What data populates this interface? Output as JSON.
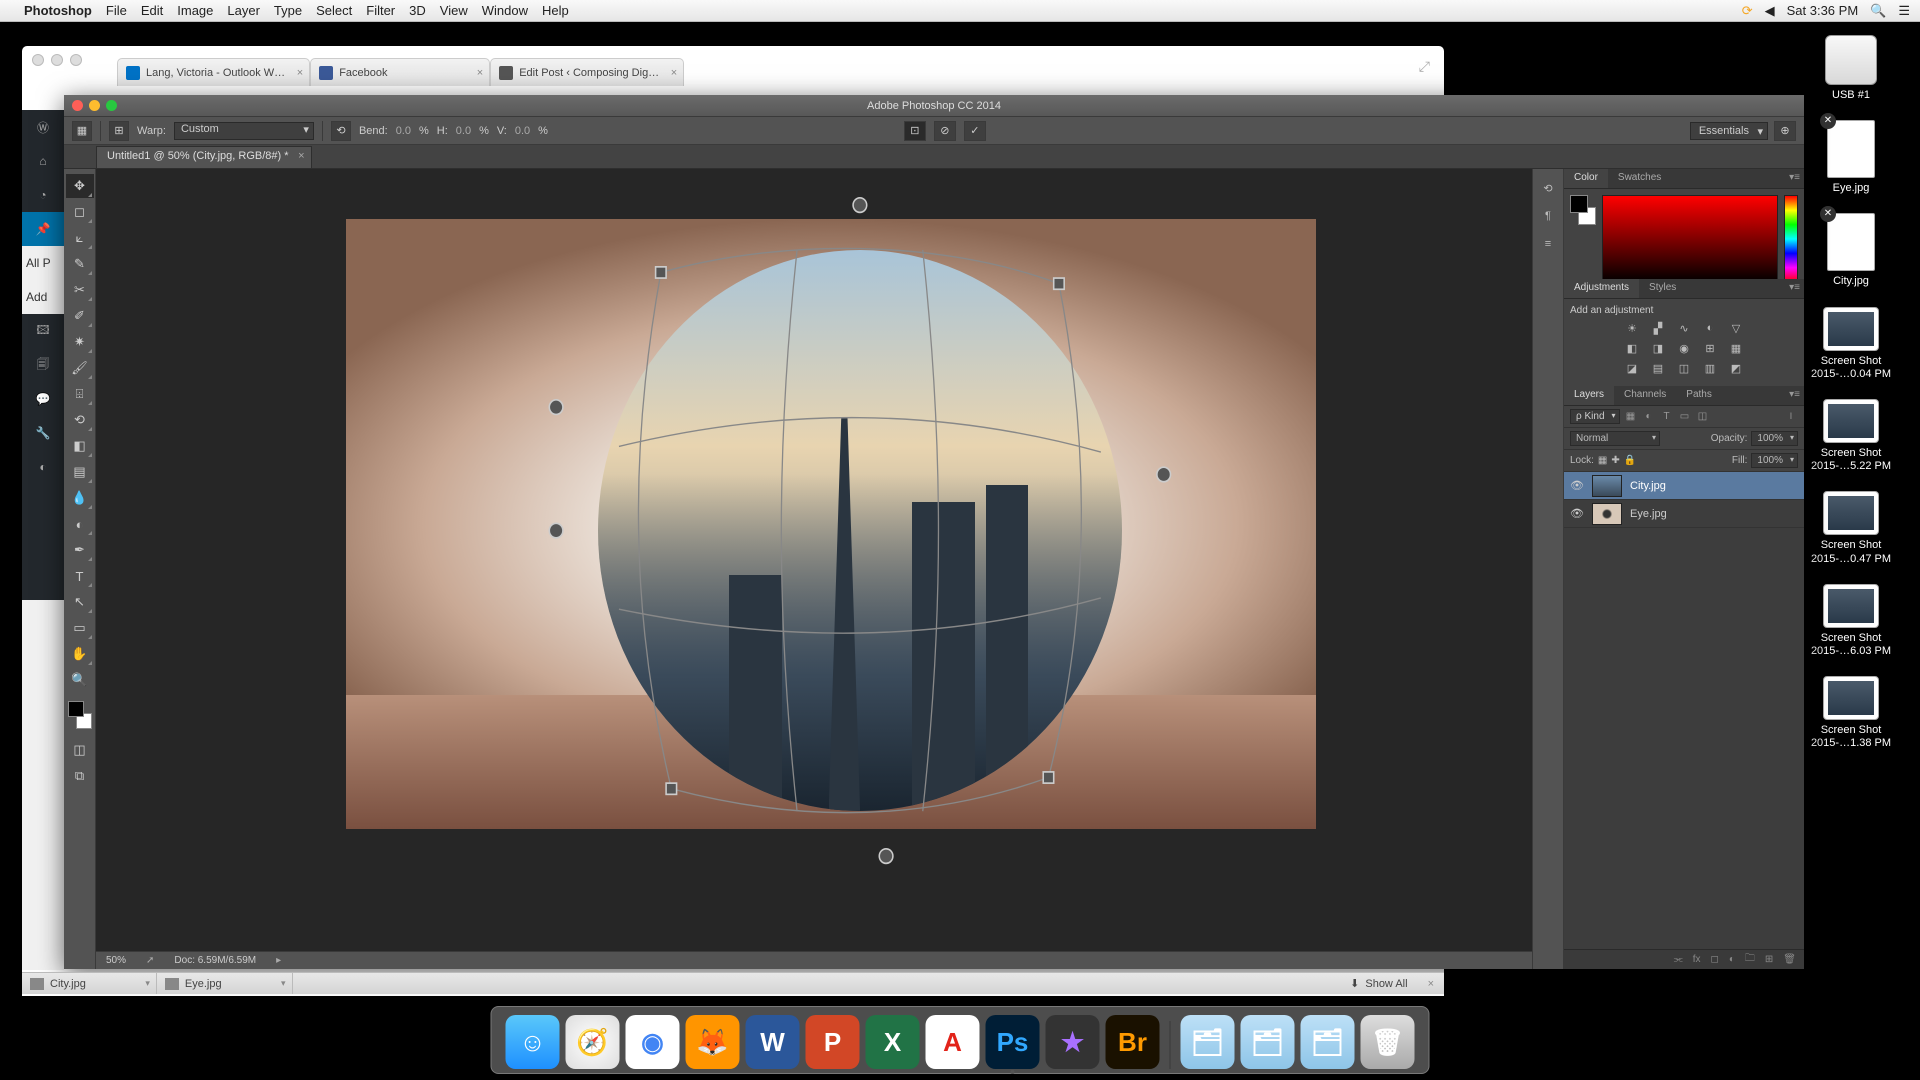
{
  "menubar": {
    "app": "Photoshop",
    "items": [
      "File",
      "Edit",
      "Image",
      "Layer",
      "Type",
      "Select",
      "Filter",
      "3D",
      "View",
      "Window",
      "Help"
    ],
    "clock": "Sat 3:36 PM"
  },
  "desktop": {
    "drive": "USB #1",
    "files": [
      "Eye.jpg",
      "City.jpg",
      "Screen Shot 2015-…0.04 PM",
      "Screen Shot 2015-…5.22 PM",
      "Screen Shot 2015-…0.47 PM",
      "Screen Shot 2015-…6.03 PM",
      "Screen Shot 2015-…1.38 PM"
    ]
  },
  "browser": {
    "tabs": [
      {
        "label": "Lang, Victoria - Outlook W…",
        "icon": "outlook"
      },
      {
        "label": "Facebook",
        "icon": "fb"
      },
      {
        "label": "Edit Post ‹ Composing Dig…",
        "icon": "wp"
      }
    ]
  },
  "wp_sidebar": {
    "items": [
      "D",
      "☆",
      "J",
      "📌",
      "P",
      "A",
      "P",
      "F",
      "T",
      "⚙"
    ],
    "active_index": 3,
    "labels": [
      "All P",
      "Add"
    ]
  },
  "photoshop": {
    "title": "Adobe Photoshop CC 2014",
    "options": {
      "warp_label": "Warp:",
      "warp_mode": "Custom",
      "bend_label": "Bend:",
      "bend_value": "0.0",
      "h_label": "H:",
      "h_value": "0.0",
      "v_label": "V:",
      "v_value": "0.0",
      "pct": "%",
      "workspace": "Essentials"
    },
    "document_tab": "Untitled1 @ 50% (City.jpg, RGB/8#) *",
    "status": {
      "zoom": "50%",
      "doc": "Doc: 6.59M/6.59M"
    },
    "panels": {
      "color": {
        "tabs": [
          "Color",
          "Swatches"
        ],
        "active": 0
      },
      "adjustments": {
        "tabs": [
          "Adjustments",
          "Styles"
        ],
        "active": 0,
        "add_label": "Add an adjustment"
      },
      "layers": {
        "tabs": [
          "Layers",
          "Channels",
          "Paths"
        ],
        "active": 0,
        "filter_kind": "Kind",
        "blend_mode": "Normal",
        "opacity_label": "Opacity:",
        "opacity_value": "100%",
        "lock_label": "Lock:",
        "fill_label": "Fill:",
        "fill_value": "100%",
        "items": [
          {
            "name": "City.jpg",
            "selected": true,
            "thumb": "city"
          },
          {
            "name": "Eye.jpg",
            "selected": false,
            "thumb": "eye"
          }
        ]
      }
    }
  },
  "bottom_files": {
    "items": [
      "City.jpg",
      "Eye.jpg"
    ],
    "showall": "Show All"
  },
  "dock": {
    "apps": [
      {
        "name": "finder",
        "bg": "linear-gradient(#5ac8fa,#1e90ff)",
        "glyph": "☺"
      },
      {
        "name": "safari",
        "bg": "radial-gradient(#fff,#ddd)",
        "glyph": "🧭"
      },
      {
        "name": "chrome",
        "bg": "#fff",
        "glyph": "◉",
        "color": "#4285f4"
      },
      {
        "name": "firefox",
        "bg": "#ff9500",
        "glyph": "🦊"
      },
      {
        "name": "word",
        "bg": "#2b579a",
        "glyph": "W"
      },
      {
        "name": "powerpoint",
        "bg": "#d24726",
        "glyph": "P"
      },
      {
        "name": "excel",
        "bg": "#217346",
        "glyph": "X"
      },
      {
        "name": "acrobat",
        "bg": "#fff",
        "glyph": "A",
        "color": "#e2231a"
      },
      {
        "name": "photoshop",
        "bg": "#001e36",
        "glyph": "Ps",
        "color": "#31a8ff",
        "running": true
      },
      {
        "name": "imovie",
        "bg": "#333",
        "glyph": "★",
        "color": "#a970ff"
      },
      {
        "name": "bridge",
        "bg": "#1a1100",
        "glyph": "Br",
        "color": "#ff9a00"
      }
    ],
    "folders": 3
  }
}
